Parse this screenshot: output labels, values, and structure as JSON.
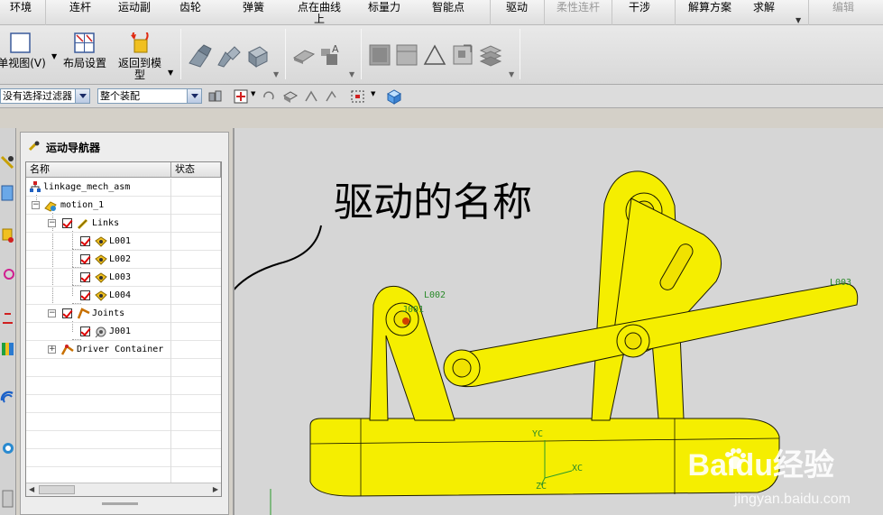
{
  "menu": {
    "items": [
      {
        "label": "环境"
      },
      {
        "label": "连杆"
      },
      {
        "label": "运动副"
      },
      {
        "label": "齿轮"
      },
      {
        "label": "弹簧"
      },
      {
        "label": "点在曲线上"
      },
      {
        "label": "标量力"
      },
      {
        "label": "智能点"
      },
      {
        "label": "驱动"
      },
      {
        "label": "柔性连杆"
      },
      {
        "label": "干涉"
      },
      {
        "label": "解算方案"
      },
      {
        "label": "求解"
      },
      {
        "label": "编辑"
      }
    ]
  },
  "toolbar": {
    "single_view_label": "单视图(V)",
    "layout_settings_label": "布局设置",
    "return_to_model_label": "返回到模型"
  },
  "filterbar": {
    "selection_filter": "没有选择过滤器",
    "scope": "整个装配"
  },
  "navigator": {
    "title": "运动导航器",
    "col_name": "名称",
    "col_status": "状态",
    "nodes": [
      {
        "label": "linkage_mech_asm"
      },
      {
        "label": "motion_1"
      },
      {
        "label": "Links"
      },
      {
        "label": "L001"
      },
      {
        "label": "L002"
      },
      {
        "label": "L003"
      },
      {
        "label": "L004"
      },
      {
        "label": "Joints"
      },
      {
        "label": "J001"
      },
      {
        "label": "Driver Container"
      }
    ]
  },
  "viewport": {
    "annotation": "驱动的名称",
    "labels": {
      "l002": "L002",
      "l003": "L003",
      "j001": "J001",
      "yc": "YC",
      "xc": "XC",
      "zc": "ZC"
    },
    "watermark_logo": "Baidu经验",
    "watermark_url": "jingyan.baidu.com",
    "model_color": "#f5ee00"
  }
}
